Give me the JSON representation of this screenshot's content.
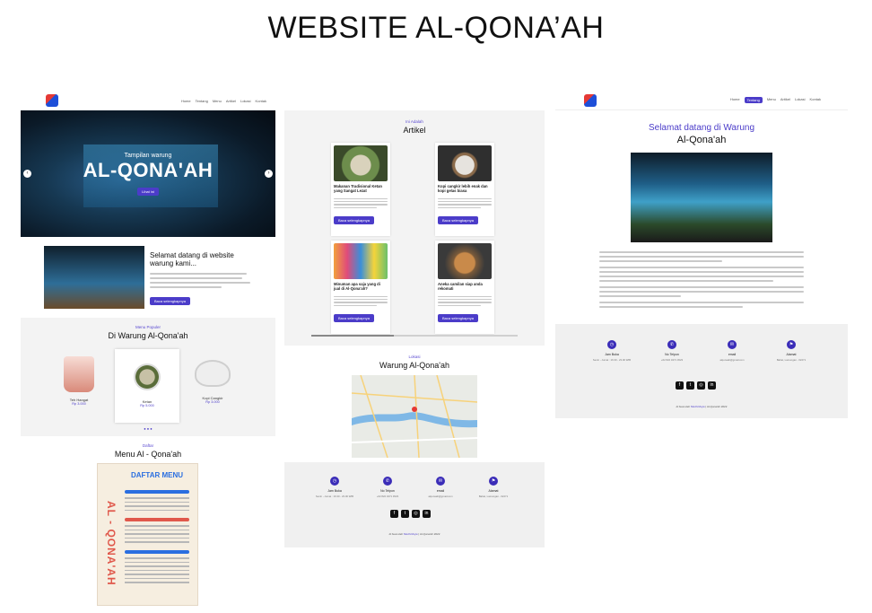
{
  "slide_title": "WEBSITE AL-QONA’AH",
  "home": {
    "nav": [
      "Home",
      "Tentang",
      "Menu",
      "Artikel",
      "Lokasi",
      "Kontak"
    ],
    "hero_small": "Tampilan warung",
    "hero_title": "AL-QONA'AH",
    "hero_button": "Lihat ini",
    "welcome_title": "Selamat datang di website warung kami...",
    "welcome_button": "Baca selengkapnya",
    "popular_kicker": "Menu Populer",
    "popular_title": "Di Warung Al-Qona'ah",
    "popular_items": [
      {
        "name": "Teh Hangat",
        "price": "Rp 3.000"
      },
      {
        "name": "Ketan",
        "price": "Rp 5.000"
      },
      {
        "name": "Kopi Cangkir",
        "price": "Rp 3.000"
      }
    ],
    "menu_kicker": "Daftar",
    "menu_title": "Menu Al - Qona'ah",
    "menu_header": "DAFTAR MENU",
    "menu_vertical": "AL - QONA'AH",
    "menu_sections": [
      "KOPI",
      "MINUMAN DINGIN",
      "MAKANAN"
    ]
  },
  "middle": {
    "artikel_kicker": "Ini Adalah",
    "artikel_title": "Artikel",
    "articles": [
      {
        "title": "Makanan Tradisional Ketan yang Sangat Lezat",
        "button": "Baca selengkapnya"
      },
      {
        "title": "Kopi cangkir lebih enak dan kopi gelas biasa",
        "button": "Baca selengkapnya"
      },
      {
        "title": "Minuman apa saja yang di jual di Al-Qona'ah?",
        "button": "Baca selengkapnya"
      },
      {
        "title": "Aneka camilan siap anda rekomati",
        "button": "Baca selengkapnya"
      }
    ],
    "lokasi_kicker": "Lokasi",
    "lokasi_title": "Warung Al-Qona'ah"
  },
  "footer": {
    "cols": [
      {
        "label": "Jam Buka",
        "value": "Senin - Jumat : 16.30 - 23.00 WIB"
      },
      {
        "label": "No Telpon",
        "value": "+62 822 3471 4523"
      },
      {
        "label": "email",
        "value": "alqonaah@gmail.com"
      },
      {
        "label": "Alamat",
        "value": "Babat, Lamongan - 62271"
      }
    ],
    "copy_prefix": "di buat oleh",
    "copy_name": "Mochrizkyw",
    "copy_suffix": "| Al-Qona'ah 2022"
  },
  "about": {
    "nav": [
      "Home",
      "Tentang",
      "Menu",
      "Artikel",
      "Lokasi",
      "Kontak"
    ],
    "active": "Tentang",
    "title_line1": "Selamat datang di Warung",
    "title_line2": "Al-Qona'ah"
  },
  "colors": {
    "accent": "#4b3cc9",
    "footer_icon": "#3b2db8"
  }
}
